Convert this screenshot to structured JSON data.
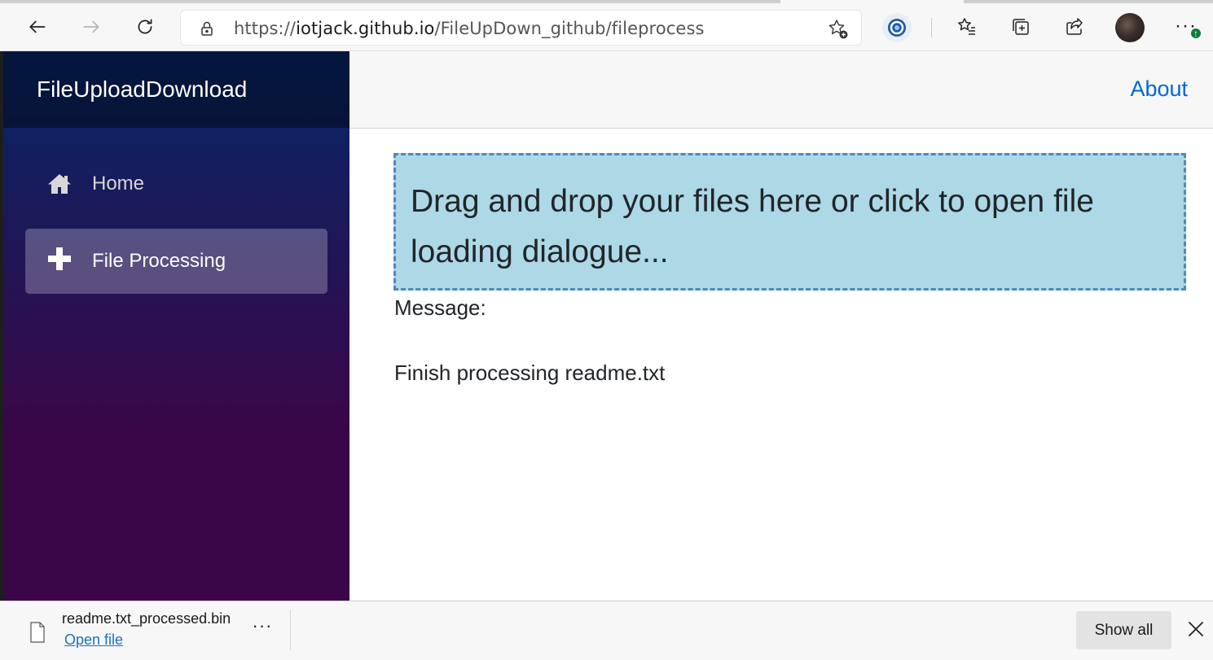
{
  "browser": {
    "url_scheme": "https://",
    "url_host": "iotjack.github.io",
    "url_path": "/FileUpDown_github/fileprocess",
    "more_label": "···",
    "badge": "↑"
  },
  "sidebar": {
    "brand": "FileUploadDownload",
    "items": [
      {
        "label": "Home",
        "icon": "home-icon",
        "active": false
      },
      {
        "label": "File Processing",
        "icon": "plus-icon",
        "active": true
      }
    ]
  },
  "topbar": {
    "about_label": "About"
  },
  "main": {
    "dropzone_text": "Drag and drop your files here or click to open file loading dialogue...",
    "message_label": "Message:",
    "message_text": "Finish processing readme.txt"
  },
  "download": {
    "filename": "readme.txt_processed.bin",
    "open_label": "Open file",
    "more_label": "···",
    "show_all_label": "Show all"
  },
  "colors": {
    "sidebar_gradient_top": "#052767",
    "sidebar_gradient_bottom": "#3a0647",
    "dropzone_bg": "#add8e6",
    "dropzone_border": "#4e88bd",
    "link": "#0366d6"
  }
}
